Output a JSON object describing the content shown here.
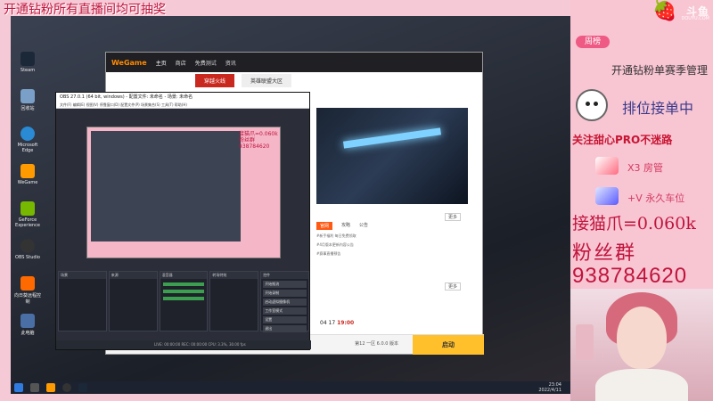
{
  "stream_banner": "开通钻粉所有直播间均可抽奖",
  "desktop": {
    "icons": [
      "Steam",
      "回收站",
      "Microsoft Edge",
      "WeGame",
      "GeForce Experience",
      "OBS Studio",
      "向日葵远程控制",
      "此电脑"
    ],
    "clock_time": "23:04",
    "clock_date": "2022/4/11"
  },
  "wegame": {
    "logo": "WeGame",
    "nav": [
      "主页",
      "商店",
      "免费测试",
      "资讯"
    ],
    "tabs": [
      "穿越火线",
      "英雄联盟大区"
    ],
    "news_tabs": [
      "官网",
      "攻略",
      "公告"
    ],
    "news_lines": [
      "#新手福利 每日免费领取",
      "#4月版本更新内容公告",
      "#赛事直播预告"
    ],
    "more_label": "更多",
    "match_time": "04 17",
    "match_clock": "19:00",
    "version": "第12 一区 6.0.0 版本",
    "start_label": "启动"
  },
  "obs": {
    "title": "OBS 27.0.1 (64 bit, windows) - 配置文件: 未命名 - 场景: 未命名",
    "menu": "文件(F)  编辑(E)  视图(V)  停靠窗口(D)  配置文件(P)  场景集合(S)  工具(T)  帮助(H)",
    "preview_text": "接猫爪=0.060k 粉丝群 938784620",
    "docks": [
      "场景",
      "来源",
      "混音器",
      "转场特效",
      "控件"
    ],
    "controls": [
      "开始推流",
      "开始录制",
      "启动虚拟摄像机",
      "工作室模式",
      "设置",
      "退出"
    ],
    "status": "LIVE: 00:00:00   REC: 00:00:00   CPU: 3.3%, 30.00 fps"
  },
  "panel": {
    "brand": "斗鱼",
    "brand_sub": "DOUYU.COM",
    "rank_badge": "周榜",
    "line1": "开通钻粉单赛季管理",
    "line2": "排位接单中",
    "line3": "关注甜心PRO不迷路",
    "gift1": "X3 房管",
    "gift2": "+V 永久车位",
    "big1": "接猫爪=0.060k",
    "big2": "粉丝群",
    "big3": "938784620"
  }
}
